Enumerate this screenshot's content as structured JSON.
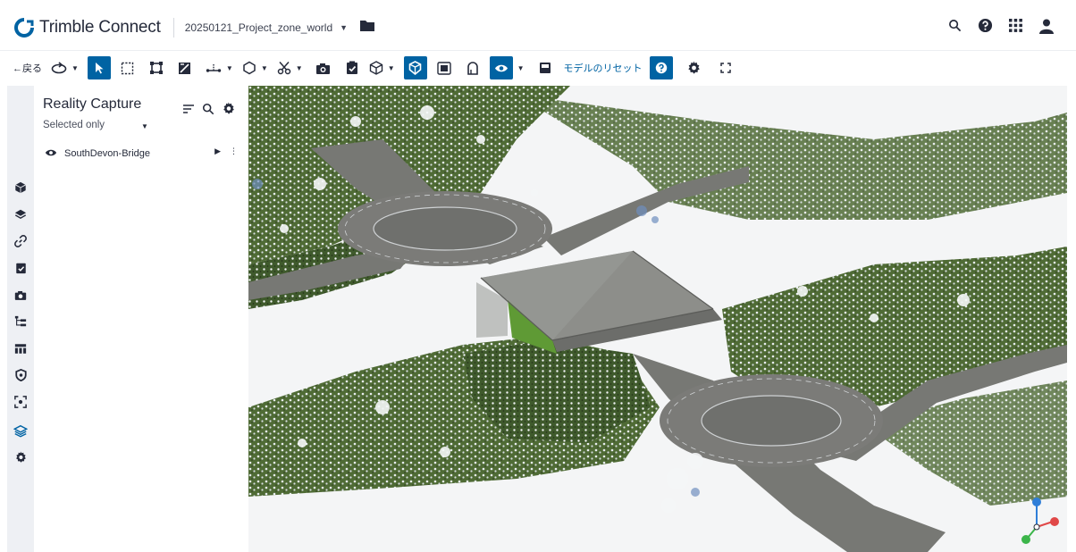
{
  "app": {
    "brand": "Trimble Connect",
    "project": "20250121_Project_zone_world"
  },
  "toolbar": {
    "back_label": "←戻る",
    "reset_label": "モデルのリセット"
  },
  "panel": {
    "title": "Reality Capture",
    "filter_label": "Selected only",
    "items": [
      {
        "label": "SouthDevon-Bridge"
      }
    ]
  },
  "colors": {
    "accent": "#0063a3",
    "text": "#252a3a",
    "iconbar": "#eef0f4",
    "grass": "#5b7a3c",
    "road": "#7b7b78",
    "bridge_green": "#5f9a35"
  },
  "icons": {
    "top_right": [
      "search-icon",
      "help-icon",
      "apps-grid-icon",
      "user-icon"
    ],
    "iconbar": [
      "cube-icon",
      "layers-icon",
      "link-icon",
      "checklist-icon",
      "camera-icon",
      "tree-structure-icon",
      "table-icon",
      "shield-icon",
      "focus-frame-icon",
      "reality-capture-icon",
      "gear-icon"
    ]
  }
}
